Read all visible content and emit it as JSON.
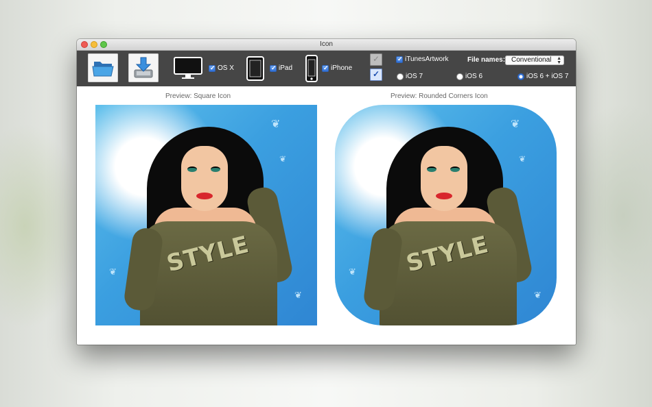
{
  "window": {
    "title": "Icon"
  },
  "toolbar": {
    "open_icon": "folder-icon",
    "save_icon": "download-icon",
    "platforms": [
      {
        "icon": "monitor-icon",
        "label": "OS X",
        "checked": true
      },
      {
        "icon": "ipad-icon",
        "label": "iPad",
        "checked": true
      },
      {
        "icon": "iphone-icon",
        "label": "iPhone",
        "checked": true
      }
    ],
    "square_toggle_checked": false,
    "rounded_toggle_checked": true,
    "itunes_artwork": {
      "label": "iTunesArtwork",
      "checked": true
    },
    "file_names": {
      "label": "File names:",
      "value": "Conventional"
    },
    "ios_options": [
      {
        "label": "iOS 7",
        "selected": false
      },
      {
        "label": "iOS 6",
        "selected": false
      },
      {
        "label": "iOS 6 + iOS 7",
        "selected": true
      }
    ]
  },
  "previews": {
    "square_title": "Preview: Square Icon",
    "rounded_title": "Preview: Rounded Corners Icon",
    "artwork_text": "STYLE"
  },
  "colors": {
    "toolbar_bg": "#464646",
    "accent_blue": "#2f6fd6",
    "art_sky": "#3b9fe0"
  }
}
